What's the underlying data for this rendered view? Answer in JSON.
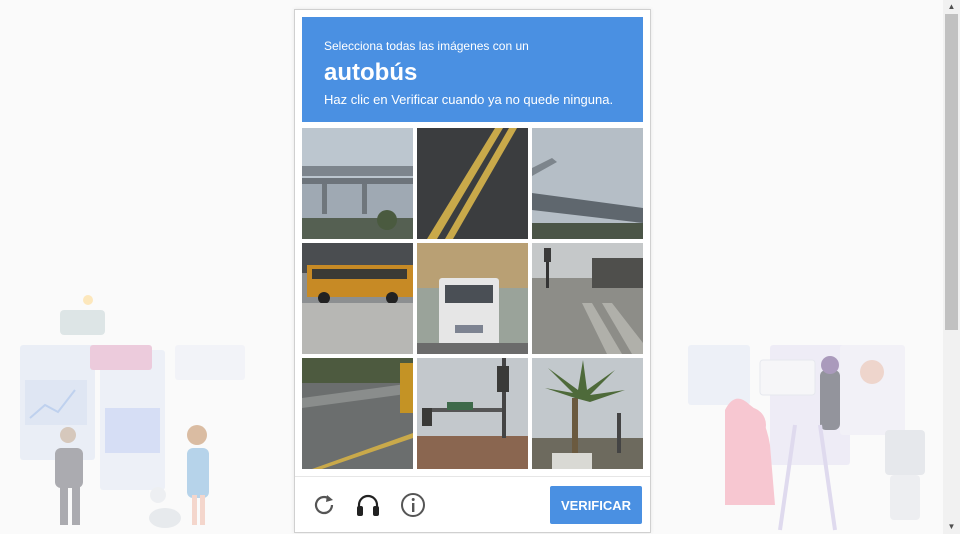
{
  "captcha": {
    "instruction_prefix": "Selecciona todas las imágenes con un",
    "target_object": "autobús",
    "instruction_suffix": "Haz clic en Verificar cuando ya no quede ninguna.",
    "verify_label": "VERIFICAR",
    "tiles": [
      {
        "content": "highway overpass"
      },
      {
        "content": "road with yellow lines"
      },
      {
        "content": "highway overpass from below"
      },
      {
        "content": "yellow school bus"
      },
      {
        "content": "white bus rear"
      },
      {
        "content": "street crosswalk with traffic light"
      },
      {
        "content": "road with yellow vehicle"
      },
      {
        "content": "traffic light and street sign"
      },
      {
        "content": "palm trees"
      }
    ],
    "footer_icons": [
      "reload-icon",
      "audio-headphones-icon",
      "info-icon"
    ]
  },
  "colors": {
    "accent": "#4a90e2",
    "header_text": "#ffffff"
  }
}
